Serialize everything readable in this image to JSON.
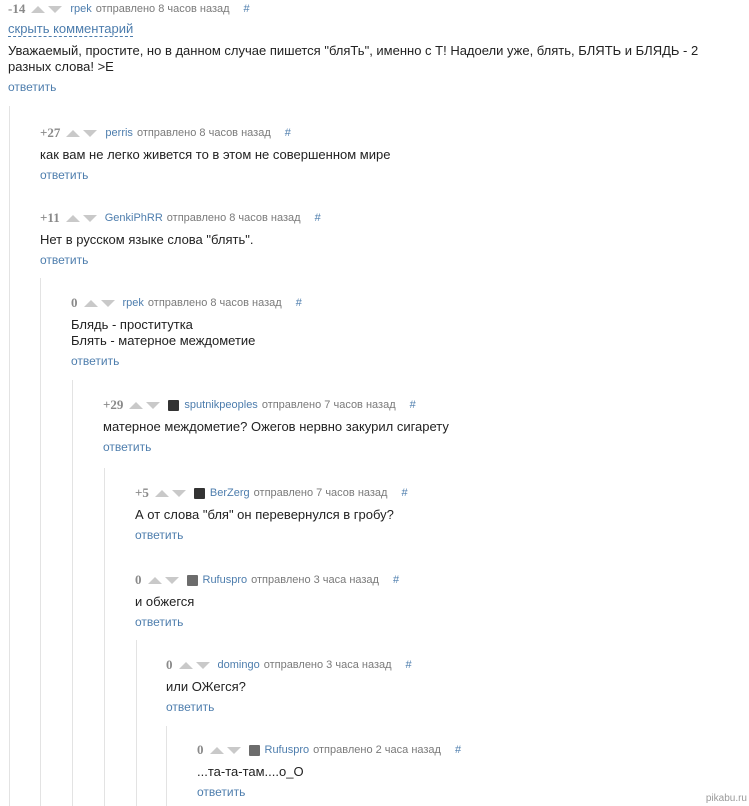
{
  "hide_comment_label": "скрыть комментарий",
  "reply_label": "ответить",
  "hash_label": "#",
  "comments": [
    {
      "score": "-14",
      "author": "rpek",
      "meta": "отправлено 8 часов назад",
      "text": [
        "Уважаемый, простите, но в данном случае пишется \"бляТь\", именно с Т! Надоели уже, блять, БЛЯТЬ и БЛЯДЬ - 2",
        "разных слова! >E"
      ]
    },
    {
      "score": "+27",
      "author": "perris",
      "meta": "отправлено 8 часов назад",
      "text": [
        "как вам не легко живется то в этом не совершенном мире"
      ]
    },
    {
      "score": "+11",
      "author": "GenkiPhRR",
      "meta": "отправлено 8 часов назад",
      "text": [
        "Нет в русском языке слова \"блять\"."
      ]
    },
    {
      "score": "0",
      "author": "rpek",
      "meta": "отправлено 8 часов назад",
      "text": [
        "Блядь - проститутка",
        "Блять - матерное междометие"
      ]
    },
    {
      "score": "+29",
      "author": "sputnikpeoples",
      "meta": "отправлено 7 часов назад",
      "text": [
        "матерное междометие? Ожегов нервно закурил сигарету"
      ]
    },
    {
      "score": "+5",
      "author": "BerZerg",
      "meta": "отправлено 7 часов назад",
      "text": [
        "А от слова \"бля\" он перевернулся в гробу?"
      ]
    },
    {
      "score": "0",
      "author": "Rufuspro",
      "meta": "отправлено 3 часа назад",
      "text": [
        "и обжегся"
      ]
    },
    {
      "score": "0",
      "author": "domingo",
      "meta": "отправлено 3 часа назад",
      "text": [
        "или ОЖегся?"
      ]
    },
    {
      "score": "0",
      "author": "Rufuspro",
      "meta": "отправлено 2 часа назад",
      "text": [
        "...та-та-там....о_О"
      ]
    }
  ],
  "watermark": "pikabu.ru"
}
